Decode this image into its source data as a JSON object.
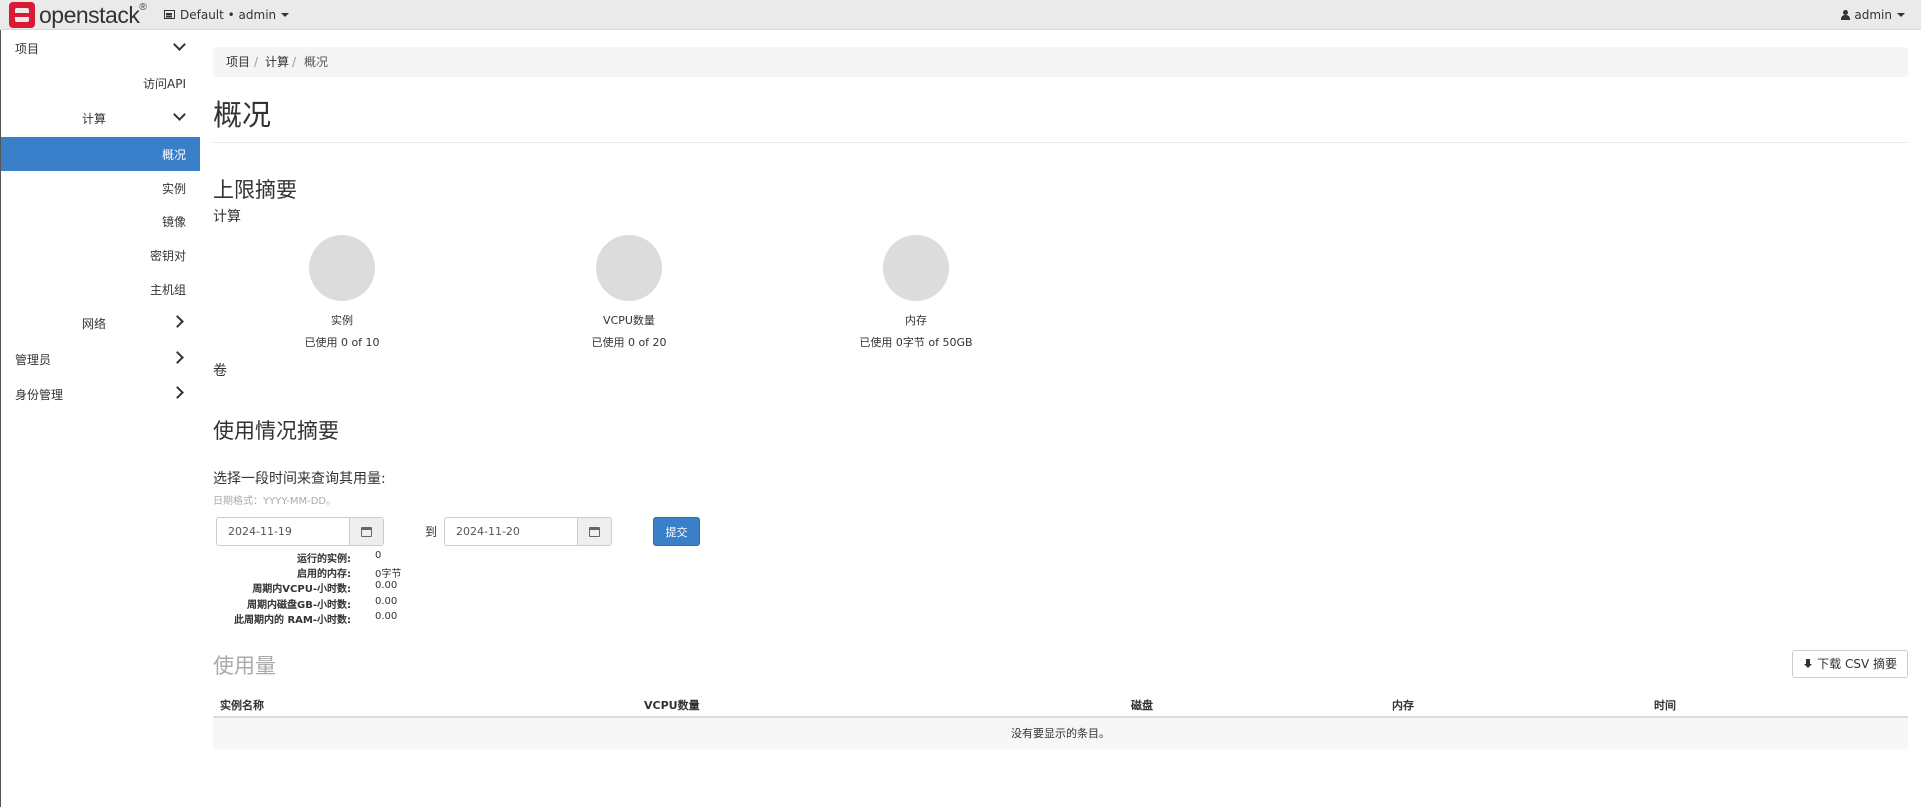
{
  "header": {
    "brand": "openstack",
    "brand_mark": "®",
    "project_switch": "Default • admin",
    "user_menu": "admin"
  },
  "sidebar": {
    "items": [
      {
        "label": "项目",
        "level": 0,
        "expanded": true
      },
      {
        "label": "访问API",
        "level": 2
      },
      {
        "label": "计算",
        "level": 1,
        "expanded": true
      },
      {
        "label": "概况",
        "level": 2,
        "active": true
      },
      {
        "label": "实例",
        "level": 2
      },
      {
        "label": "镜像",
        "level": 2
      },
      {
        "label": "密钥对",
        "level": 2
      },
      {
        "label": "主机组",
        "level": 2
      },
      {
        "label": "网络",
        "level": 1,
        "expanded": false
      },
      {
        "label": "管理员",
        "level": 0,
        "expanded": false
      },
      {
        "label": "身份管理",
        "level": 0,
        "expanded": false
      }
    ]
  },
  "breadcrumb": [
    "项目",
    "计算",
    "概况"
  ],
  "breadcrumb_sep": "/",
  "page_title": "概况",
  "limits": {
    "title": "上限摘要",
    "compute_heading": "计算",
    "volume_heading": "卷",
    "charts": [
      {
        "title": "实例",
        "used_text": "已使用 0 of 10",
        "used": 0,
        "total": 10
      },
      {
        "title": "VCPU数量",
        "used_text": "已使用 0 of 20",
        "used": 0,
        "total": 20
      },
      {
        "title": "内存",
        "used_text": "已使用 0字节 of 50GB",
        "used": 0,
        "total": 50
      }
    ]
  },
  "usage_summary": {
    "title": "使用情况摘要",
    "date_label": "选择一段时间来查询其用量:",
    "date_help": "日期格式：YYYY-MM-DD。",
    "start_date": "2024-11-19",
    "to_label": "到",
    "end_date": "2024-11-20",
    "submit_label": "提交",
    "stats": [
      {
        "key": "运行的实例:",
        "value": "0"
      },
      {
        "key": "启用的内存:",
        "value": "0字节"
      },
      {
        "key": "周期内VCPU-小时数:",
        "value": "0.00"
      },
      {
        "key": "周期内磁盘GB-小时数:",
        "value": "0.00"
      },
      {
        "key": "此周期内的 RAM-小时数:",
        "value": "0.00"
      }
    ]
  },
  "usage": {
    "title": "使用量",
    "download_label": "下载 CSV 摘要",
    "columns": [
      "实例名称",
      "VCPU数量",
      "磁盘",
      "内存",
      "时间"
    ],
    "empty_text": "没有要显示的条目。"
  },
  "colors": {
    "accent": "#3a7fc9",
    "brand_red": "#da1a32",
    "topbar": "#eaeaea"
  }
}
